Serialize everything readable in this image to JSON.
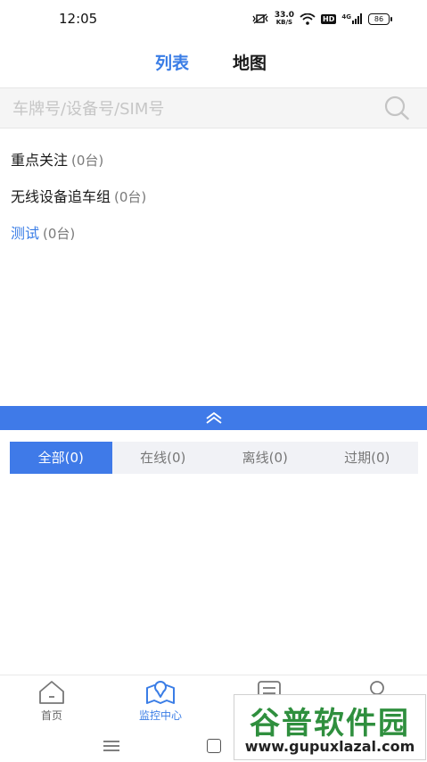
{
  "status_bar": {
    "time": "12:05",
    "net_speed_value": "33.0",
    "net_speed_unit": "KB/S",
    "hd": "HD",
    "signal": "4G",
    "battery": "86"
  },
  "top_tabs": [
    {
      "label": "列表",
      "active": true
    },
    {
      "label": "地图",
      "active": false
    }
  ],
  "search": {
    "placeholder": "车牌号/设备号/SIM号",
    "value": "",
    "icon": "search-icon"
  },
  "groups": [
    {
      "name": "重点关注",
      "count": "(0台)"
    },
    {
      "name": "无线设备追车组",
      "count": "(0台)"
    },
    {
      "name": "测试",
      "count": "(0台)"
    }
  ],
  "filter_tabs": [
    {
      "label": "全部(0)",
      "active": true
    },
    {
      "label": "在线(0)",
      "active": false
    },
    {
      "label": "离线(0)",
      "active": false
    },
    {
      "label": "过期(0)",
      "active": false
    }
  ],
  "bottom_nav": [
    {
      "label": "首页",
      "icon": "home-icon",
      "active": false
    },
    {
      "label": "监控中心",
      "icon": "monitor-map-icon",
      "active": true
    },
    {
      "label": "",
      "icon": "report-icon",
      "active": false
    },
    {
      "label": "",
      "icon": "user-icon",
      "active": false
    }
  ],
  "watermark": {
    "title": "谷普软件园",
    "url": "www.gupuxlazal.com"
  },
  "colors": {
    "accent": "#3a7de6",
    "bar": "#3f7ae8",
    "watermark_green": "#2f8f3e"
  }
}
